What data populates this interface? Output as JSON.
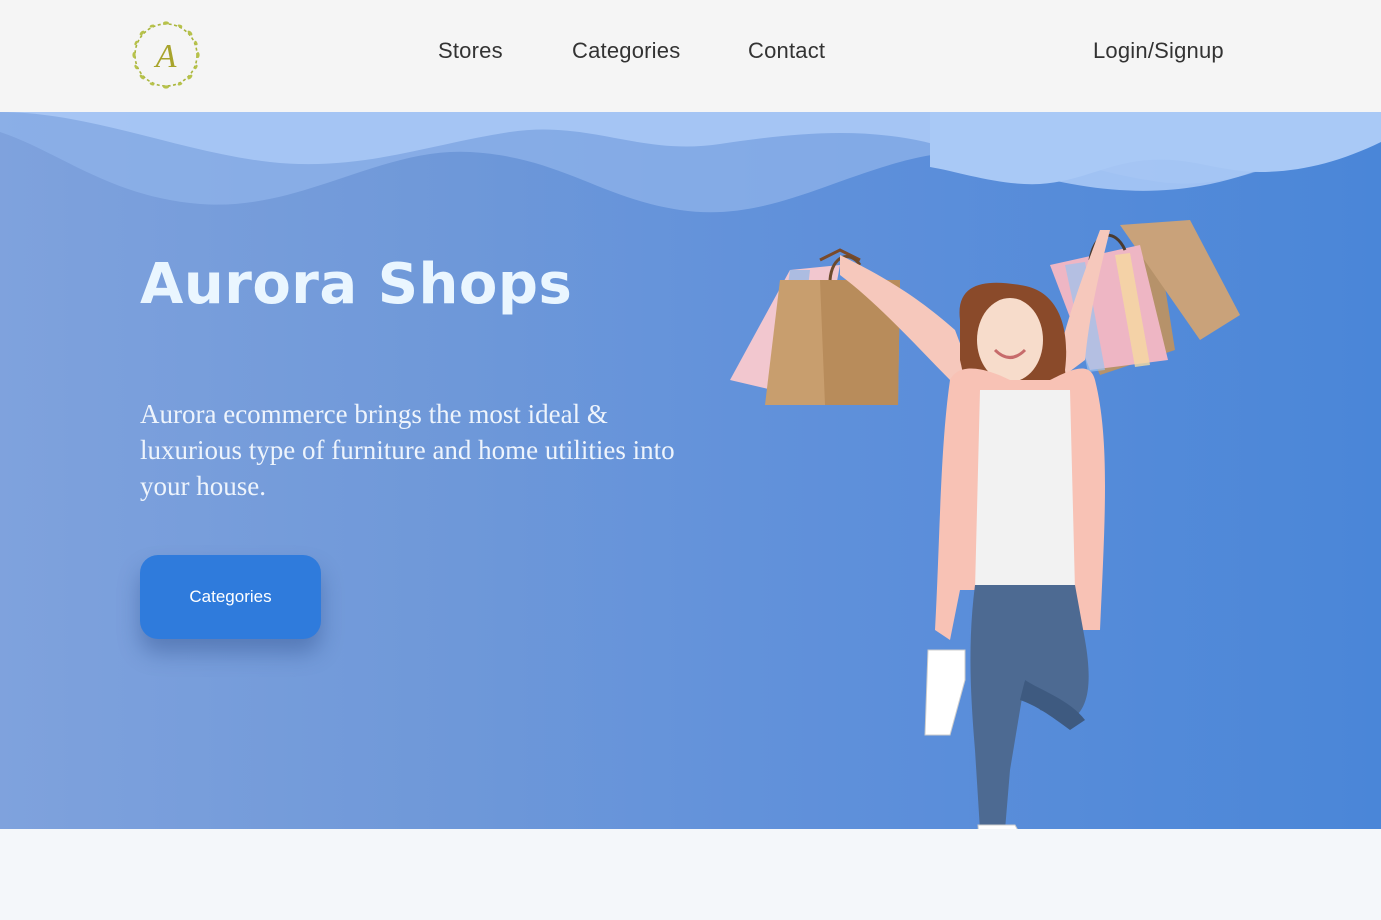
{
  "nav": {
    "logo_letter": "A",
    "links": [
      {
        "label": "Stores"
      },
      {
        "label": "Categories"
      },
      {
        "label": "Contact"
      }
    ],
    "login_label": "Login/Signup"
  },
  "hero": {
    "title": "Aurora Shops",
    "description": "Aurora ecommerce brings the most ideal & luxurious type of furniture and home utilities into your house.",
    "button_label": "Categories"
  },
  "colors": {
    "nav_bg": "#f5f5f5",
    "hero_gradient_start": "#7fa2dd",
    "hero_gradient_end": "#4a86d8",
    "button": "#2f7bdc",
    "logo_gold": "#a8a42c"
  }
}
